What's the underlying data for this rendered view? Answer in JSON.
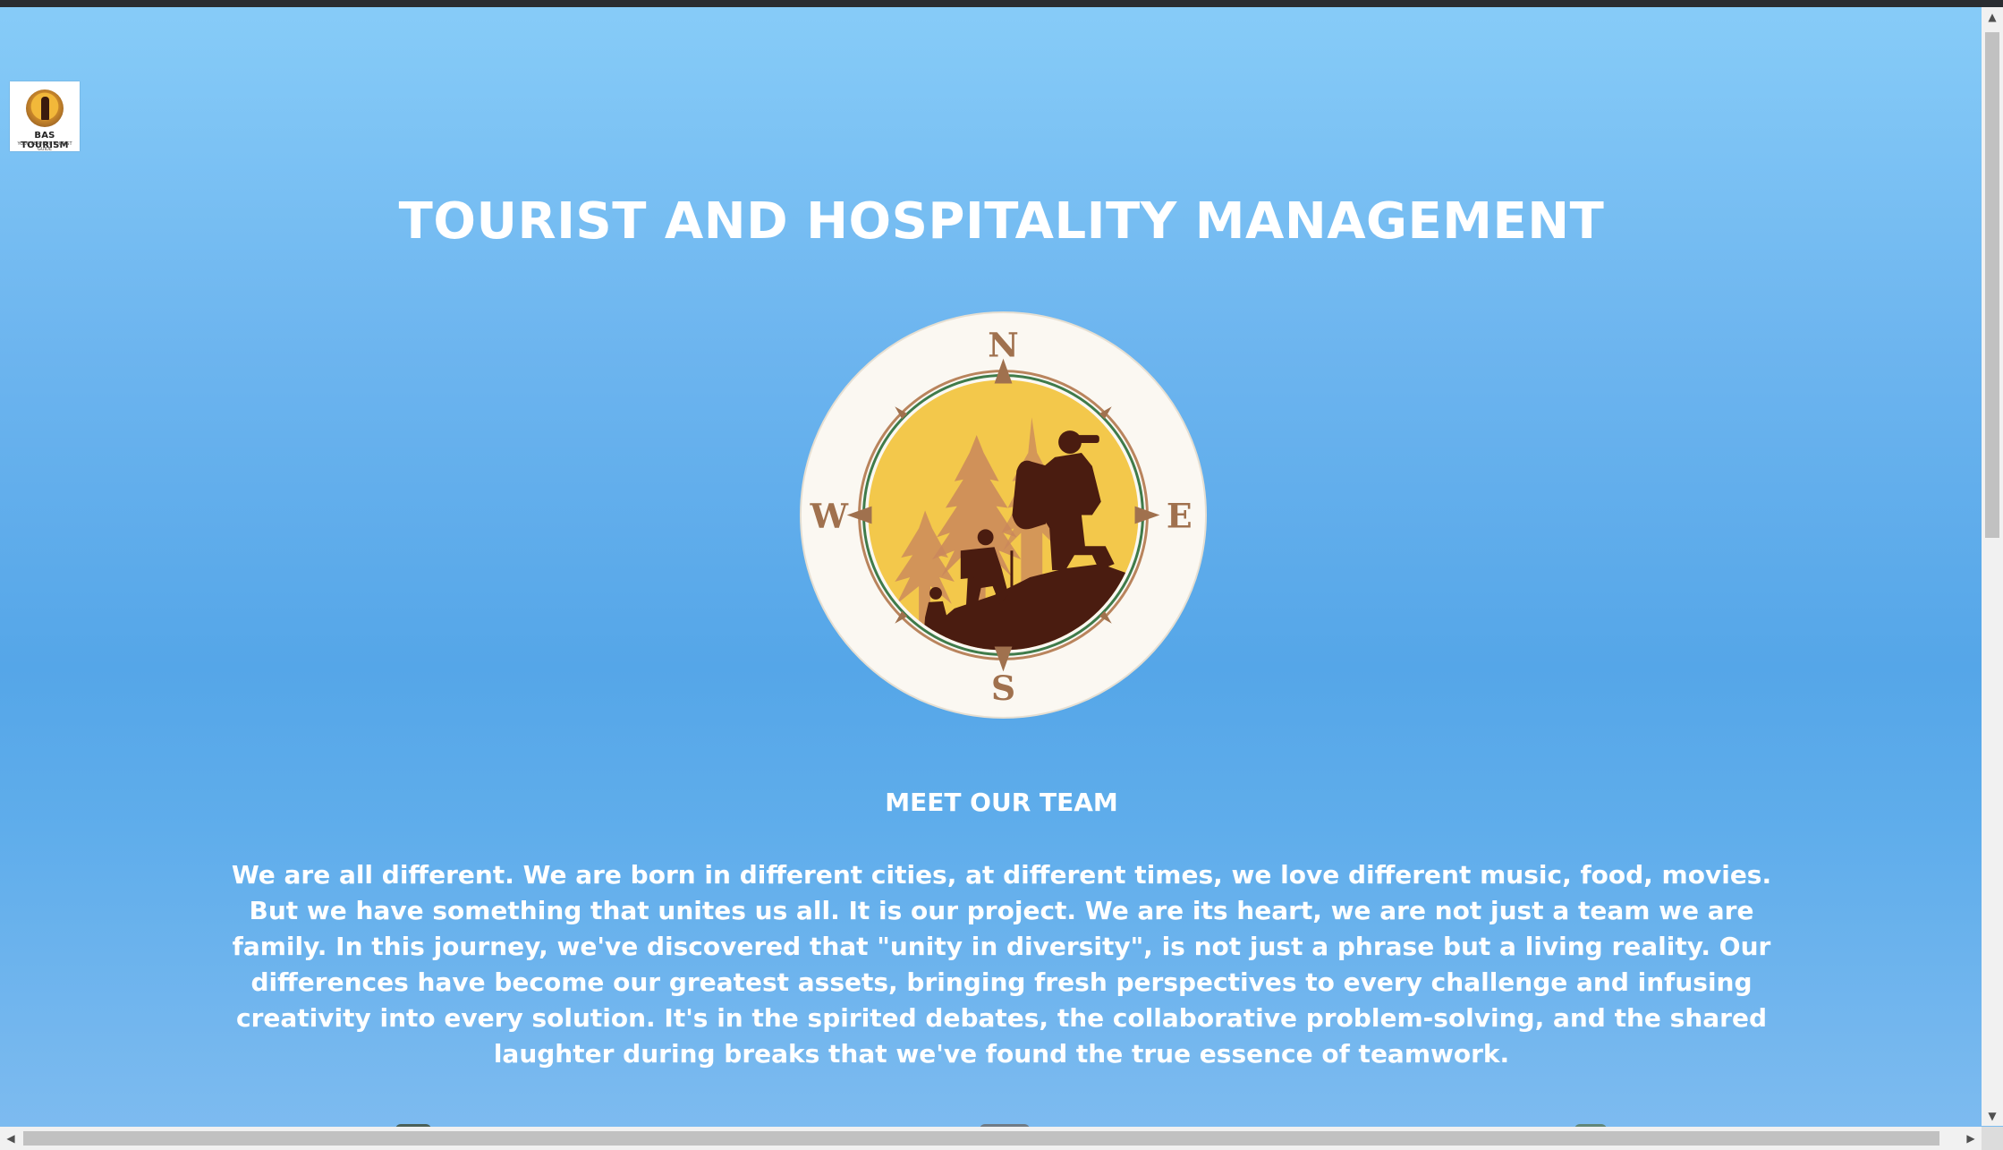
{
  "logo": {
    "name": "BAS TOURISM",
    "tagline": "YOUR PERFECT TOURIST GUIDE"
  },
  "header": {
    "title": "TOURIST AND HOSPITALITY MANAGEMENT"
  },
  "compass": {
    "north": "N",
    "south": "S",
    "east": "E",
    "west": "W"
  },
  "team": {
    "heading": "MEET OUR TEAM",
    "text": "We are all different. We are born in different cities, at different times, we love different music, food, movies. But we have something that unites us all. It is our project. We are its heart, we are not just a team we are family. In this journey, we've discovered that \"unity in diversity\", is not just a phrase but a living reality. Our differences have become our greatest assets, bringing fresh perspectives to every challenge and infusing creativity into every solution. It's in the spirited debates, the collaborative problem-solving, and the shared laughter during breaks that we've found the true essence of teamwork."
  },
  "scrollbar": {
    "up_icon": "▲",
    "down_icon": "▼",
    "left_icon": "◀",
    "right_icon": "▶"
  },
  "colors": {
    "background_top": "#87ccf8",
    "background_mid": "#55a6e8",
    "text": "#ffffff",
    "compass_brown": "#a0714e",
    "compass_gold": "#f3c84b",
    "silhouette": "#4a1c10"
  }
}
